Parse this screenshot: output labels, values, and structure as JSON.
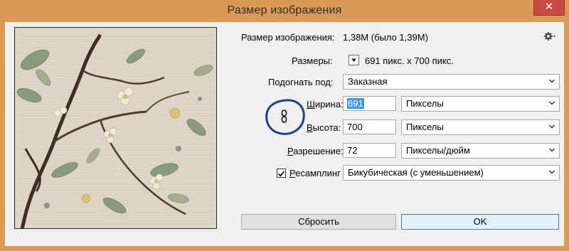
{
  "window": {
    "title": "Размер изображения",
    "close_label": "✕"
  },
  "image_size": {
    "label": "Размер изображения:",
    "value": "1,38M (было 1,39M)"
  },
  "dimensions": {
    "label": "Размеры:",
    "value": "691 пикс. x 700 пикс."
  },
  "fit_to": {
    "label": "Подогнать под:",
    "value": "Заказная"
  },
  "width": {
    "label_underlined": "Ш",
    "label_rest": "ирина:",
    "value": "691",
    "unit": "Пикселы"
  },
  "height": {
    "label_underlined": "В",
    "label_rest": "ысота:",
    "value": "700",
    "unit": "Пикселы"
  },
  "resolution": {
    "label_underlined": "Р",
    "label_rest": "азрешение:",
    "value": "72",
    "unit": "Пикселы/дюйм"
  },
  "resample": {
    "checked": true,
    "label_underlined": "Р",
    "label_rest": "есамплинг",
    "value": "Бикубическая (с уменьшением)"
  },
  "buttons": {
    "reset": "Сбросить",
    "ok": "OK"
  },
  "colors": {
    "title_bar": "#d99a55",
    "close_button": "#c74a44",
    "dialog_bg": "#f0f0f0",
    "selection": "#3399ff",
    "annotation_circle": "#1f3f8f"
  },
  "icons": {
    "settings": "gear-icon",
    "dimensions_toggle": "triangle-down-icon",
    "constrain": "chain-link-icon",
    "dropdown": "chevron-down-icon",
    "checkbox": "checkmark-icon"
  }
}
